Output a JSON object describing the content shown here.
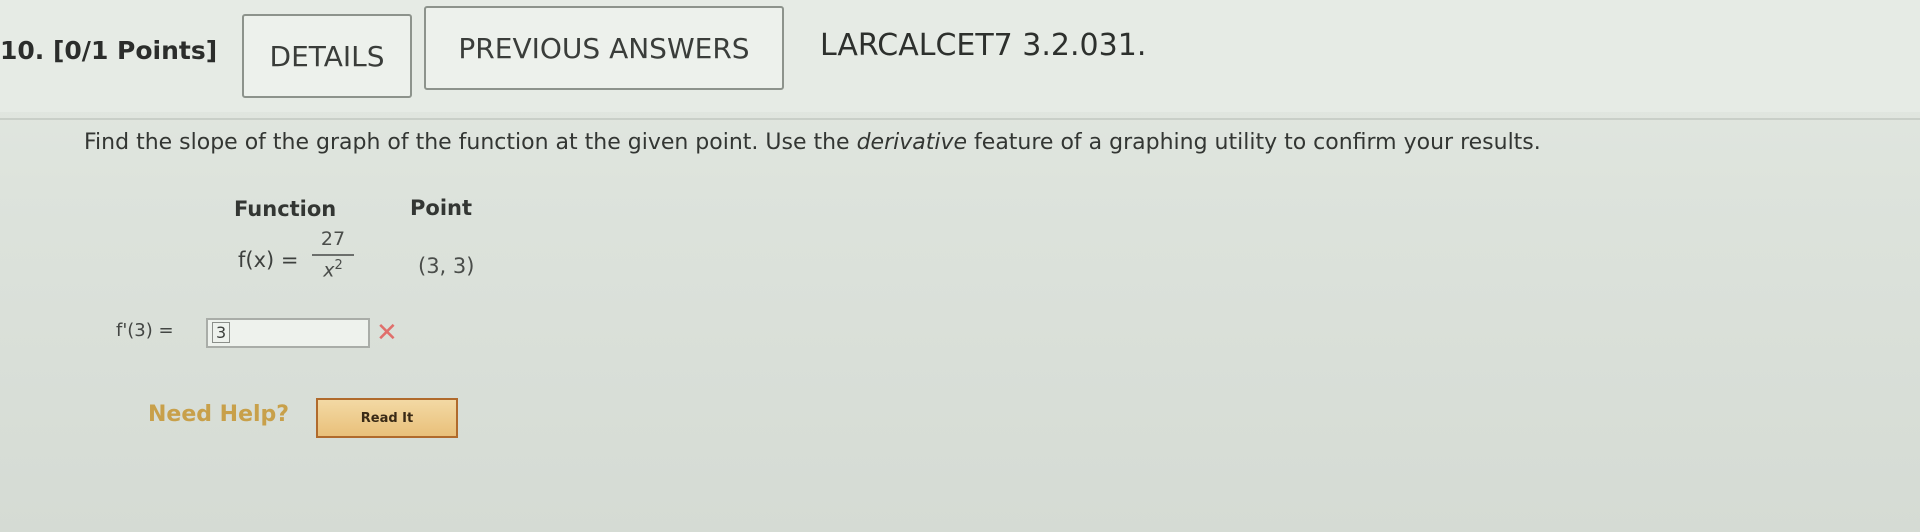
{
  "question": {
    "number_label": "10. [0/1 Points]",
    "details_button": "DETAILS",
    "previous_answers_button": "PREVIOUS ANSWERS",
    "problem_code": "LARCALCET7 3.2.031."
  },
  "prompt": {
    "part1": "Find the slope of the graph of the function at the given point. Use the ",
    "emphasis": "derivative",
    "part2": " feature of a graphing utility to confirm your results."
  },
  "table": {
    "function_header": "Function",
    "point_header": "Point",
    "fx_label": "f(x) =",
    "numerator": "27",
    "denominator_var": "x",
    "denominator_exp": "2",
    "point_value": "(3, 3)"
  },
  "answer": {
    "label": "f'(3) =",
    "value": "3",
    "status_icon": "wrong-x-icon",
    "status_color": "#e06f6b"
  },
  "help": {
    "label": "Need Help?",
    "read_button": "Read It"
  }
}
